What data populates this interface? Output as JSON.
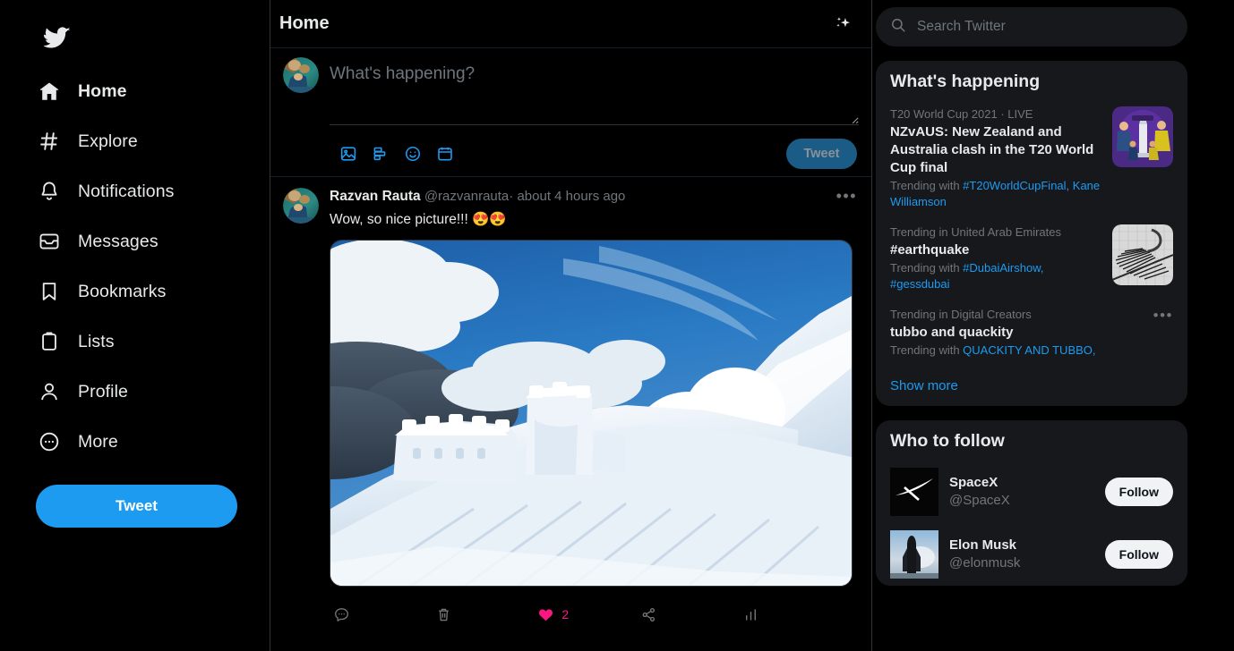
{
  "brand": {
    "color": "#1d9bf0",
    "logo_icon": "twitter-bird-icon"
  },
  "sidebar": {
    "items": [
      {
        "label": "Home",
        "icon": "home-icon",
        "active": true
      },
      {
        "label": "Explore",
        "icon": "hashtag-icon",
        "active": false
      },
      {
        "label": "Notifications",
        "icon": "bell-icon",
        "active": false
      },
      {
        "label": "Messages",
        "icon": "envelope-icon",
        "active": false
      },
      {
        "label": "Bookmarks",
        "icon": "bookmark-icon",
        "active": false
      },
      {
        "label": "Lists",
        "icon": "clipboard-icon",
        "active": false
      },
      {
        "label": "Profile",
        "icon": "person-icon",
        "active": false
      },
      {
        "label": "More",
        "icon": "more-circle-icon",
        "active": false
      }
    ],
    "tweet_button": "Tweet"
  },
  "center": {
    "title": "Home",
    "sparkle_icon": "sparkles-icon",
    "compose": {
      "placeholder": "What's happening?",
      "value": "",
      "icons": [
        "image-icon",
        "poll-icon",
        "emoji-icon",
        "schedule-icon"
      ],
      "tweet_button": "Tweet",
      "tweet_button_disabled": true
    },
    "tweet": {
      "author_name": "Razvan Rauta",
      "author_handle": "@razvanrauta",
      "separator": "·",
      "timestamp": "about 4 hours ago",
      "more_icon": "more-horizontal-icon",
      "text": "Wow, so nice picture!!! 😍😍",
      "media_alt": "snow-covered mountain ridge with ice-encrusted stone fortress under blue sky",
      "actions": [
        {
          "name": "reply",
          "icon": "comment-icon",
          "count": ""
        },
        {
          "name": "delete",
          "icon": "trash-icon",
          "count": ""
        },
        {
          "name": "like",
          "icon": "heart-filled-icon",
          "count": "2",
          "active": true,
          "color": "#f91880"
        },
        {
          "name": "share",
          "icon": "share-icon",
          "count": ""
        },
        {
          "name": "analytics",
          "icon": "bar-chart-icon",
          "count": ""
        }
      ]
    }
  },
  "right": {
    "search": {
      "placeholder": "Search Twitter",
      "value": "",
      "icon": "search-icon"
    },
    "whats_happening": {
      "title": "What's happening",
      "trends": [
        {
          "category": "T20 World Cup 2021 · LIVE",
          "name": "NZvAUS: New Zealand and Australia clash in the T20 World Cup final",
          "trending_with_label": "Trending with ",
          "tags": [
            "#T20WorldCupFinal,",
            "Kane Williamson"
          ],
          "thumb": "t20-world-cup-trophy-thumb",
          "has_thumb": true,
          "has_dots": false
        },
        {
          "category": "Trending in United Arab Emirates",
          "name": "#earthquake",
          "trending_with_label": "Trending with ",
          "tags": [
            "#DubaiAirshow,",
            "#gessdubai"
          ],
          "thumb": "seismograph-thumb",
          "has_thumb": true,
          "has_dots": false
        },
        {
          "category": "Trending in Digital Creators",
          "name": "tubbo and quackity",
          "trending_with_label": "Trending with ",
          "tags": [
            "QUACKITY AND TUBBO,"
          ],
          "thumb": "",
          "has_thumb": false,
          "has_dots": true
        }
      ],
      "show_more": "Show more"
    },
    "who_to_follow": {
      "title": "Who to follow",
      "accounts": [
        {
          "name": "SpaceX",
          "handle": "@SpaceX",
          "avatar": "spacex-logo-avatar",
          "follow_label": "Follow"
        },
        {
          "name": "Elon Musk",
          "handle": "@elonmusk",
          "avatar": "starship-rocket-avatar",
          "follow_label": "Follow"
        }
      ]
    }
  }
}
